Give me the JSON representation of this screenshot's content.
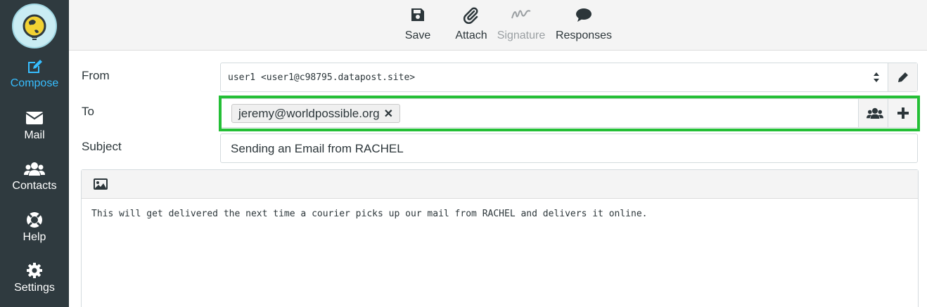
{
  "sidebar": {
    "items": [
      {
        "label": "Compose",
        "icon": "compose-icon",
        "active": true
      },
      {
        "label": "Mail",
        "icon": "envelope-icon"
      },
      {
        "label": "Contacts",
        "icon": "users-icon"
      },
      {
        "label": "Help",
        "icon": "lifebuoy-icon"
      },
      {
        "label": "Settings",
        "icon": "gear-icon"
      }
    ]
  },
  "toolbar": {
    "save_label": "Save",
    "attach_label": "Attach",
    "signature_label": "Signature",
    "responses_label": "Responses"
  },
  "form": {
    "from_label": "From",
    "from_value": "user1 <user1@c98795.datapost.site>",
    "to_label": "To",
    "recipients": [
      "jeremy@worldpossible.org"
    ],
    "subject_label": "Subject",
    "subject_value": "Sending an Email from RACHEL"
  },
  "editor": {
    "body": "This will get delivered the next time a courier picks up our mail from RACHEL and delivers it online."
  },
  "colors": {
    "sidebar_bg": "#2f3a3f",
    "accent": "#37beff",
    "highlight": "#24bf36"
  }
}
